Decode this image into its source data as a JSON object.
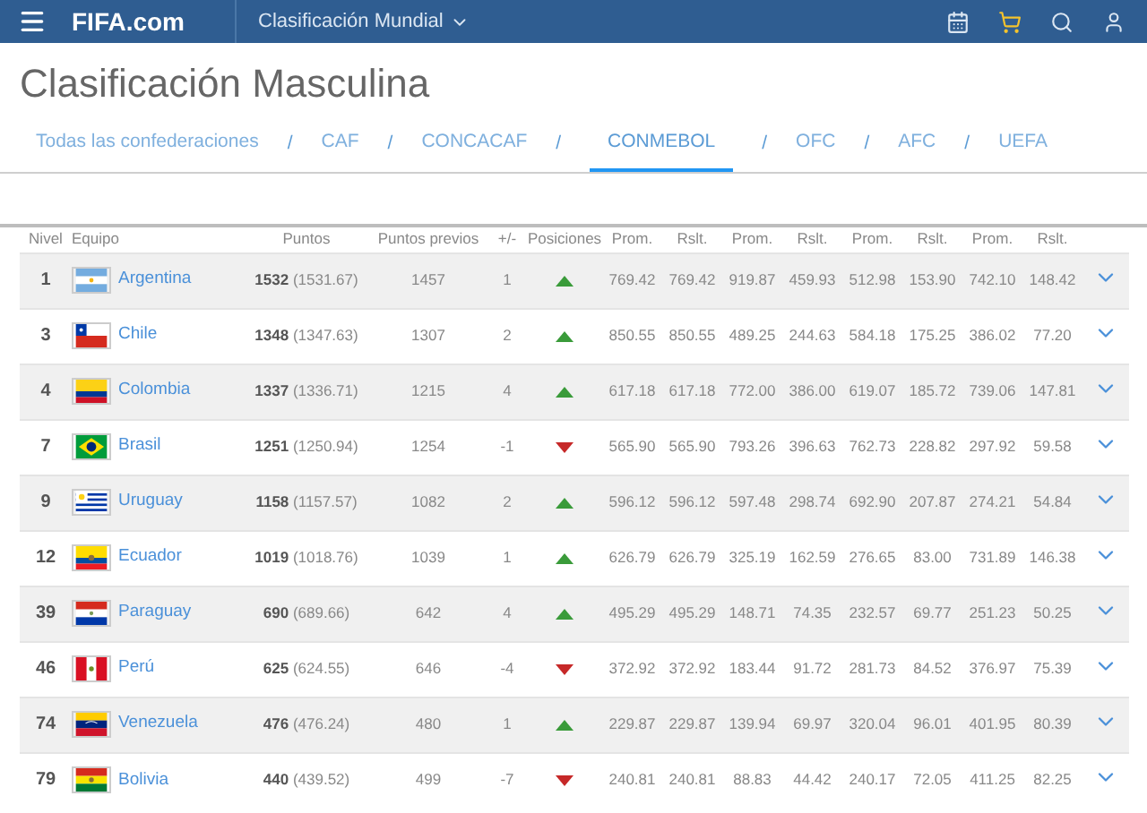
{
  "header": {
    "logo": "FIFA.com",
    "section": "Clasificación Mundial"
  },
  "title": "Clasificación Masculina",
  "tabs": [
    {
      "label": "Todas las confederaciones",
      "selected": false
    },
    {
      "label": "CAF",
      "selected": false
    },
    {
      "label": "CONCACAF",
      "selected": false
    },
    {
      "label": "CONMEBOL",
      "selected": true
    },
    {
      "label": "OFC",
      "selected": false
    },
    {
      "label": "AFC",
      "selected": false
    },
    {
      "label": "UEFA",
      "selected": false
    }
  ],
  "tab_separator": "/",
  "table": {
    "columns": [
      "Nivel",
      "Equipo",
      "Puntos",
      "Puntos previos",
      "+/-",
      "Posiciones",
      "Prom.",
      "Rslt.",
      "Prom.",
      "Rslt.",
      "Prom.",
      "Rslt.",
      "Prom.",
      "Rslt."
    ],
    "rows": [
      {
        "rank": "1",
        "team": "Argentina",
        "kind": "argentina",
        "points": "**1532** (1531.67)",
        "previous": "1457",
        "change": "1",
        "rising": true,
        "values": [
          "769.42",
          "769.42",
          "919.87",
          "459.93",
          "512.98",
          "153.90",
          "742.10",
          "148.42"
        ]
      },
      {
        "rank": "3",
        "team": "Chile",
        "kind": "chile",
        "points": "**1348** (1347.63)",
        "previous": "1307",
        "change": "2",
        "rising": true,
        "values": [
          "850.55",
          "850.55",
          "489.25",
          "244.63",
          "584.18",
          "175.25",
          "386.02",
          "77.20"
        ]
      },
      {
        "rank": "4",
        "team": "Colombia",
        "kind": "colombia",
        "points": "**1337** (1336.71)",
        "previous": "1215",
        "change": "4",
        "rising": true,
        "values": [
          "617.18",
          "617.18",
          "772.00",
          "386.00",
          "619.07",
          "185.72",
          "739.06",
          "147.81"
        ]
      },
      {
        "rank": "7",
        "team": "Brasil",
        "kind": "brazil",
        "points": "**1251** (1250.94)",
        "previous": "1254",
        "change": "-1",
        "rising": false,
        "values": [
          "565.90",
          "565.90",
          "793.26",
          "396.63",
          "762.73",
          "228.82",
          "297.92",
          "59.58"
        ]
      },
      {
        "rank": "9",
        "team": "Uruguay",
        "kind": "uruguay",
        "points": "**1158** (1157.57)",
        "previous": "1082",
        "change": "2",
        "rising": true,
        "values": [
          "596.12",
          "596.12",
          "597.48",
          "298.74",
          "692.90",
          "207.87",
          "274.21",
          "54.84"
        ]
      },
      {
        "rank": "12",
        "team": "Ecuador",
        "kind": "ecuador",
        "points": "**1019** (1018.76)",
        "previous": "1039",
        "change": "1",
        "rising": true,
        "values": [
          "626.79",
          "626.79",
          "325.19",
          "162.59",
          "276.65",
          "83.00",
          "731.89",
          "146.38"
        ]
      },
      {
        "rank": "39",
        "team": "Paraguay",
        "kind": "paraguay",
        "points": "**690** (689.66)",
        "previous": "642",
        "change": "4",
        "rising": true,
        "values": [
          "495.29",
          "495.29",
          "148.71",
          "74.35",
          "232.57",
          "69.77",
          "251.23",
          "50.25"
        ]
      },
      {
        "rank": "46",
        "team": "Perú",
        "kind": "peru",
        "points": "**625** (624.55)",
        "previous": "646",
        "change": "-4",
        "rising": false,
        "values": [
          "372.92",
          "372.92",
          "183.44",
          "91.72",
          "281.73",
          "84.52",
          "376.97",
          "75.39"
        ]
      },
      {
        "rank": "74",
        "team": "Venezuela",
        "kind": "venezuela",
        "points": "**476** (476.24)",
        "previous": "480",
        "change": "1",
        "rising": true,
        "values": [
          "229.87",
          "229.87",
          "139.94",
          "69.97",
          "320.04",
          "96.01",
          "401.95",
          "80.39"
        ]
      },
      {
        "rank": "79",
        "team": "Bolivia",
        "kind": "bolivia",
        "points": "**440** (439.52)",
        "previous": "499",
        "change": "-7",
        "rising": false,
        "values": [
          "240.81",
          "240.81",
          "88.83",
          "44.42",
          "240.17",
          "72.05",
          "411.25",
          "82.25"
        ]
      }
    ]
  }
}
